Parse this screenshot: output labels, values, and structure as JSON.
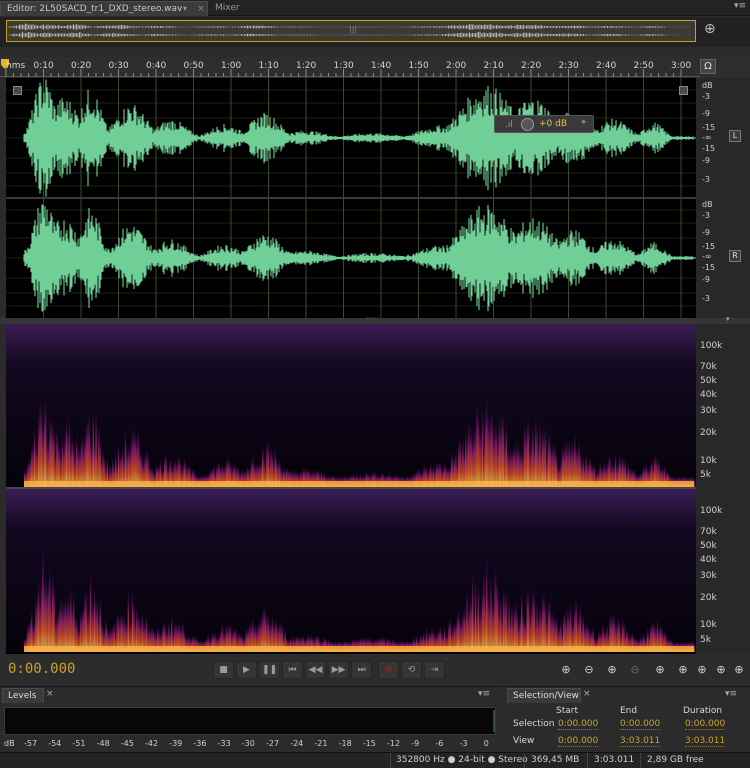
{
  "tabs": {
    "editor": "Editor: 2L50SACD_tr1_DXD_stereo.wav",
    "mixer": "Mixer"
  },
  "icons": {
    "tab_dropdown": "▾",
    "tab_close": "×",
    "panel_menu": "▾≡",
    "overview_handle": "|||",
    "zoom_navigator": "⊕",
    "headphones": "Ω",
    "gain_bars": ".ıl",
    "pin": "⌖"
  },
  "ruler": {
    "unit": "hms",
    "ticks": [
      "0:10",
      "0:20",
      "0:30",
      "0:40",
      "0:50",
      "1:00",
      "1:10",
      "1:20",
      "1:30",
      "1:40",
      "1:50",
      "2:00",
      "2:10",
      "2:20",
      "2:30",
      "2:40",
      "2:50",
      "3:00"
    ]
  },
  "db_scale": [
    "dB",
    "-3",
    "-9",
    "-15",
    "-∞",
    "-15",
    "-9",
    "-3"
  ],
  "channels": {
    "left": "L",
    "right": "R"
  },
  "gain_hud": {
    "value": "+0 dB"
  },
  "freq_scale": [
    "100k",
    "70k",
    "50k",
    "40k",
    "30k",
    "20k",
    "10k",
    "5k"
  ],
  "transport": {
    "time": "0:00.000",
    "buttons": [
      "■",
      "▶",
      "❚❚",
      "⏮",
      "◀◀",
      "▶▶",
      "⏭",
      "●",
      "⟲",
      "⇥"
    ],
    "zoom_buttons": [
      "⊕",
      "⊖",
      "⊕",
      "⊖",
      "⊕",
      "⊕",
      "⊕",
      "⊕",
      "⊕"
    ]
  },
  "levels": {
    "title": "Levels",
    "scale": [
      "dB",
      "-57",
      "-54",
      "-51",
      "-48",
      "-45",
      "-42",
      "-39",
      "-36",
      "-33",
      "-30",
      "-27",
      "-24",
      "-21",
      "-18",
      "-15",
      "-12",
      "-9",
      "-6",
      "-3",
      "0"
    ]
  },
  "selection_view": {
    "title": "Selection/View",
    "headers": {
      "start": "Start",
      "end": "End",
      "duration": "Duration"
    },
    "selection": {
      "label": "Selection",
      "start": "0:00.000",
      "end": "0:00.000",
      "duration": "0:00.000"
    },
    "view": {
      "label": "View",
      "start": "0:00.000",
      "end": "3:03.011",
      "duration": "3:03.011"
    }
  },
  "status": {
    "format": "352800 Hz ● 24-bit ● Stereo",
    "size": "369,45 MB",
    "duration": "3:03.011",
    "free": "2,89 GB free"
  },
  "colors": {
    "waveform": "#6fcf97",
    "accent": "#c9a22f",
    "background": "#2b2b2b"
  }
}
